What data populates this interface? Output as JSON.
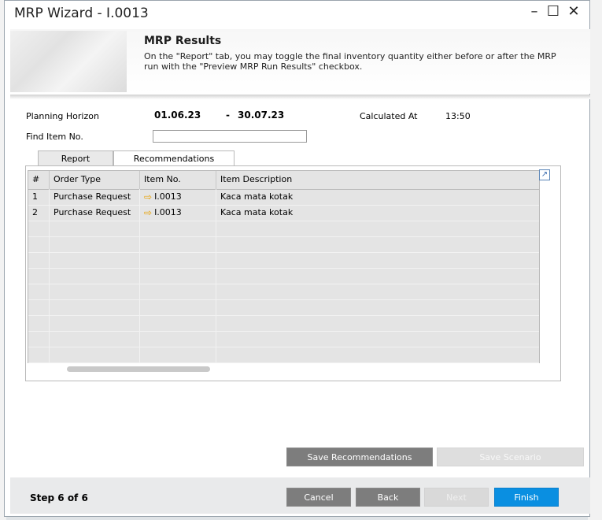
{
  "window": {
    "title": "MRP Wizard - I.0013"
  },
  "header": {
    "title": "MRP Results",
    "description": "On the \"Report\" tab, you may toggle the final inventory quantity either before or after the MRP run with the \"Preview MRP Run Results\" checkbox."
  },
  "planning": {
    "horizon_label": "Planning Horizon",
    "from": "01.06.23",
    "separator": "-",
    "to": "30.07.23",
    "calculated_label": "Calculated At",
    "calculated_value": "13:50",
    "find_label": "Find Item No.",
    "find_value": ""
  },
  "tabs": [
    {
      "label": "Report"
    },
    {
      "label": "Recommendations",
      "selected": true
    }
  ],
  "grid": {
    "columns": [
      "#",
      "Order Type",
      "Item No.",
      "Item Description"
    ],
    "rows": [
      {
        "num": "1",
        "order_type": "Purchase Request",
        "item_no": "I.0013",
        "description": "Kaca mata kotak"
      },
      {
        "num": "2",
        "order_type": "Purchase Request",
        "item_no": "I.0013",
        "description": "Kaca mata kotak"
      }
    ]
  },
  "actions": {
    "save_recommendations": "Save Recommendations",
    "save_scenario": "Save Scenario"
  },
  "footer": {
    "step": "Step 6 of 6",
    "cancel": "Cancel",
    "back": "Back",
    "next": "Next",
    "finish": "Finish"
  },
  "colors": {
    "finish_button": "#0a8fe1",
    "arrow_icon": "#e8a100",
    "grey_button": "#7d7d7d"
  }
}
